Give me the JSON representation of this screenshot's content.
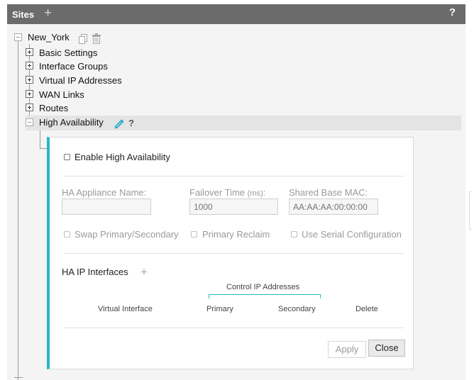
{
  "header": {
    "title": "Sites",
    "add_icon": "+",
    "help_icon": "?"
  },
  "tree": {
    "root_label": "New_York",
    "items": [
      {
        "label": "Basic Settings",
        "expanded": false
      },
      {
        "label": "Interface Groups",
        "expanded": false
      },
      {
        "label": "Virtual IP Addresses",
        "expanded": false
      },
      {
        "label": "WAN Links",
        "expanded": false
      },
      {
        "label": "Routes",
        "expanded": false
      },
      {
        "label": "High Availability",
        "expanded": true,
        "selected": true
      }
    ],
    "ha_help": "?"
  },
  "ha_form": {
    "enable_label": "Enable High Availability",
    "appliance_name_label": "HA Appliance Name:",
    "appliance_name_value": "",
    "failover_label": "Failover Time",
    "failover_unit": "(ms)",
    "failover_colon": ":",
    "failover_placeholder": "1000",
    "mac_label": "Shared Base MAC:",
    "mac_placeholder": "AA:AA:AA:00:00:00",
    "swap_label": "Swap Primary/Secondary",
    "reclaim_label": "Primary Reclaim",
    "serial_label": "Use Serial Configuration",
    "interfaces_title": "HA IP Interfaces",
    "interfaces_add": "+",
    "control_ip_label": "Control IP Addresses",
    "columns": [
      "Virtual Interface",
      "Primary",
      "Secondary",
      "Delete"
    ],
    "apply_label": "Apply",
    "close_label": "Close"
  },
  "colors": {
    "accent": "#29b6c9",
    "header_bg": "#6b6b6b",
    "pencil": "#1ea9c4"
  }
}
